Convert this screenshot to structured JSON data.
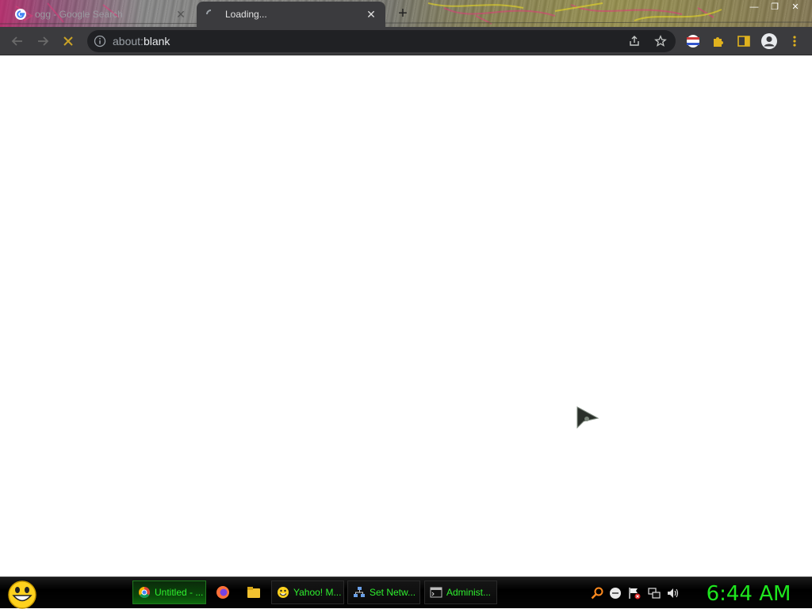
{
  "browser": {
    "tabs": [
      {
        "title": "ogg - Google Search",
        "state": "inactive"
      },
      {
        "title": "Loading...",
        "state": "active"
      }
    ],
    "address_bar": {
      "scheme": "about:",
      "host": "blank"
    }
  },
  "taskbar": {
    "tasks": [
      {
        "label": "Untitled - ...",
        "icon": "chrome-icon"
      },
      {
        "label": "Yahoo! M...",
        "icon": "yahoo-messenger-icon"
      },
      {
        "label": "Set Netw...",
        "icon": "network-icon"
      },
      {
        "label": "Administ...",
        "icon": "command-prompt-icon"
      }
    ],
    "clock": "6:44 AM"
  },
  "colors": {
    "taskbar_text": "#2ef02e",
    "clock": "#1ee61e",
    "toolbar_bg": "#3b3b3e",
    "omnibox_bg": "#202124"
  }
}
